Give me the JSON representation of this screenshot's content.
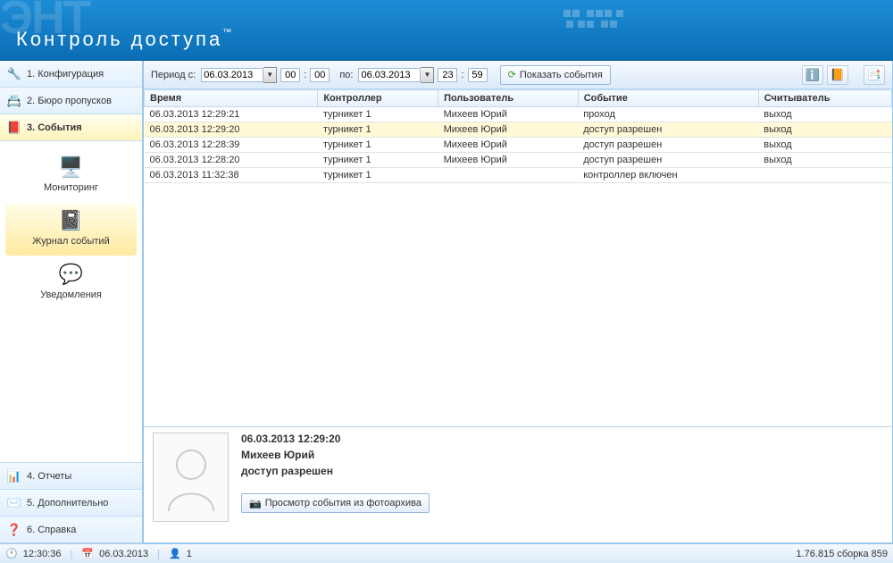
{
  "header": {
    "bg_text": "ЭНТ",
    "title": "Контроль доступа",
    "tm": "™"
  },
  "sidebar": {
    "items": [
      {
        "label": "1. Конфигурация",
        "icon": "🔧"
      },
      {
        "label": "2. Бюро пропусков",
        "icon": "📇"
      },
      {
        "label": "3. События",
        "icon": "📕"
      },
      {
        "label": "4. Отчеты",
        "icon": "📊"
      },
      {
        "label": "5. Дополнительно",
        "icon": "✉️"
      },
      {
        "label": "6. Справка",
        "icon": "❓"
      }
    ],
    "sub_items": [
      {
        "label": "Мониторинг",
        "icon": "🖥️"
      },
      {
        "label": "Журнал событий",
        "icon": "📓"
      },
      {
        "label": "Уведомления",
        "icon": "💬"
      }
    ]
  },
  "toolbar": {
    "period_label": "Период с:",
    "date_from": "06.03.2013",
    "time_from_h": "00",
    "time_from_m": "00",
    "to_label": "по:",
    "date_to": "06.03.2013",
    "time_to_h": "23",
    "time_to_m": "59",
    "show_events": "Показать события",
    "btn_info": "ℹ️",
    "btn_book": "📙",
    "btn_excel": "📑"
  },
  "grid": {
    "columns": [
      "Время",
      "Контроллер",
      "Пользователь",
      "Событие",
      "Считыватель"
    ],
    "rows": [
      {
        "time": "06.03.2013 12:29:21",
        "ctrl": "турникет 1",
        "user": "Михеев Юрий",
        "event": "проход",
        "reader": "выход",
        "sel": false
      },
      {
        "time": "06.03.2013 12:29:20",
        "ctrl": "турникет 1",
        "user": "Михеев Юрий",
        "event": "доступ разрешен",
        "reader": "выход",
        "sel": true
      },
      {
        "time": "06.03.2013 12:28:39",
        "ctrl": "турникет 1",
        "user": "Михеев Юрий",
        "event": "доступ разрешен",
        "reader": "выход",
        "sel": false
      },
      {
        "time": "06.03.2013 12:28:20",
        "ctrl": "турникет 1",
        "user": "Михеев Юрий",
        "event": "доступ разрешен",
        "reader": "выход",
        "sel": false
      },
      {
        "time": "06.03.2013 11:32:38",
        "ctrl": "турникет 1",
        "user": "",
        "event": "контроллер включен",
        "reader": "",
        "sel": false
      }
    ]
  },
  "details": {
    "time": "06.03.2013 12:29:20",
    "user": "Михеев Юрий",
    "event": "доступ разрешен",
    "photo_btn": "Просмотр события из фотоархива"
  },
  "status": {
    "time": "12:30:36",
    "date": "06.03.2013",
    "users": "1",
    "version": "1.76.815 сборка 859"
  }
}
